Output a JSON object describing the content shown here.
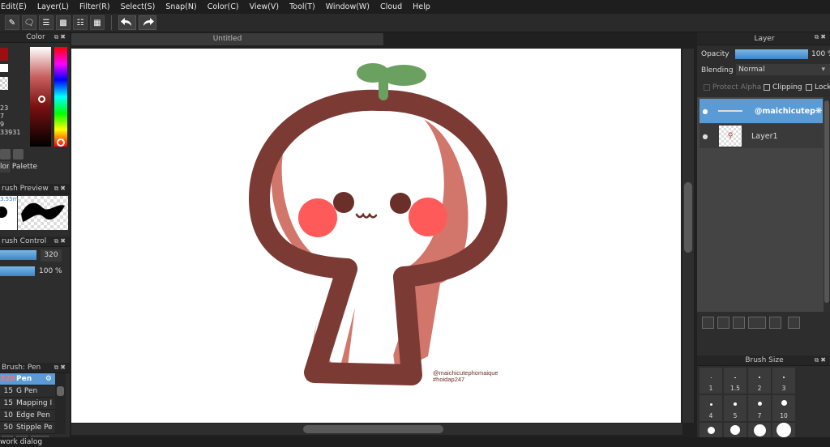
{
  "menu": [
    "Edit(E)",
    "Layer(L)",
    "Filter(R)",
    "Select(S)",
    "Snap(N)",
    "Color(C)",
    "View(V)",
    "Tool(T)",
    "Window(W)",
    "Cloud",
    "Help"
  ],
  "document": {
    "tab_title": "Untitled"
  },
  "color_panel": {
    "title": "Color",
    "values": [
      "23",
      "7",
      "9",
      "33931"
    ],
    "tabs": [
      "lor",
      "Palette"
    ]
  },
  "brush_preview": {
    "title": "rush Preview",
    "size_label": "3.55m"
  },
  "brush_control": {
    "title": "rush Control",
    "size_value": "320",
    "size_fill": 1.0,
    "opacity_value": "100 %",
    "opacity_fill": 1.0
  },
  "brush_list": {
    "title": "Brush: Pen",
    "items": [
      {
        "size": "320",
        "name": "Pen",
        "selected": true
      },
      {
        "size": "15",
        "name": "G Pen",
        "selected": false
      },
      {
        "size": "15",
        "name": "Mapping I",
        "selected": false
      },
      {
        "size": "10",
        "name": "Edge Pen",
        "selected": false
      },
      {
        "size": "50",
        "name": "Stipple Pe",
        "selected": false
      }
    ]
  },
  "layer_panel": {
    "title": "Layer",
    "opacity_label": "Opacity",
    "opacity_value": "100 %",
    "opacity_fill": 1.0,
    "blending_label": "Blending",
    "blending_value": "Normal",
    "protect_alpha": "Protect Alpha",
    "clipping": "Clipping",
    "lock": "Lock",
    "layers": [
      {
        "name": "@maichicutep",
        "selected": true
      },
      {
        "name": "Layer1",
        "selected": false
      }
    ]
  },
  "brush_size_panel": {
    "title": "Brush Size",
    "sizes": [
      "1",
      "1.5",
      "2",
      "3",
      "4",
      "5",
      "7",
      "10"
    ]
  },
  "artwork": {
    "watermark_line1": "@maichicutephomaique",
    "watermark_line2": "#hoidap247"
  },
  "status": {
    "text": "work dialog"
  },
  "colors": {
    "accent": "#5b9bd5",
    "outline": "#7b3a33",
    "inner_shade": "#d2766c",
    "blush": "#ff5a5a",
    "leaf": "#6aa060",
    "eyes": "#6b2f29"
  }
}
